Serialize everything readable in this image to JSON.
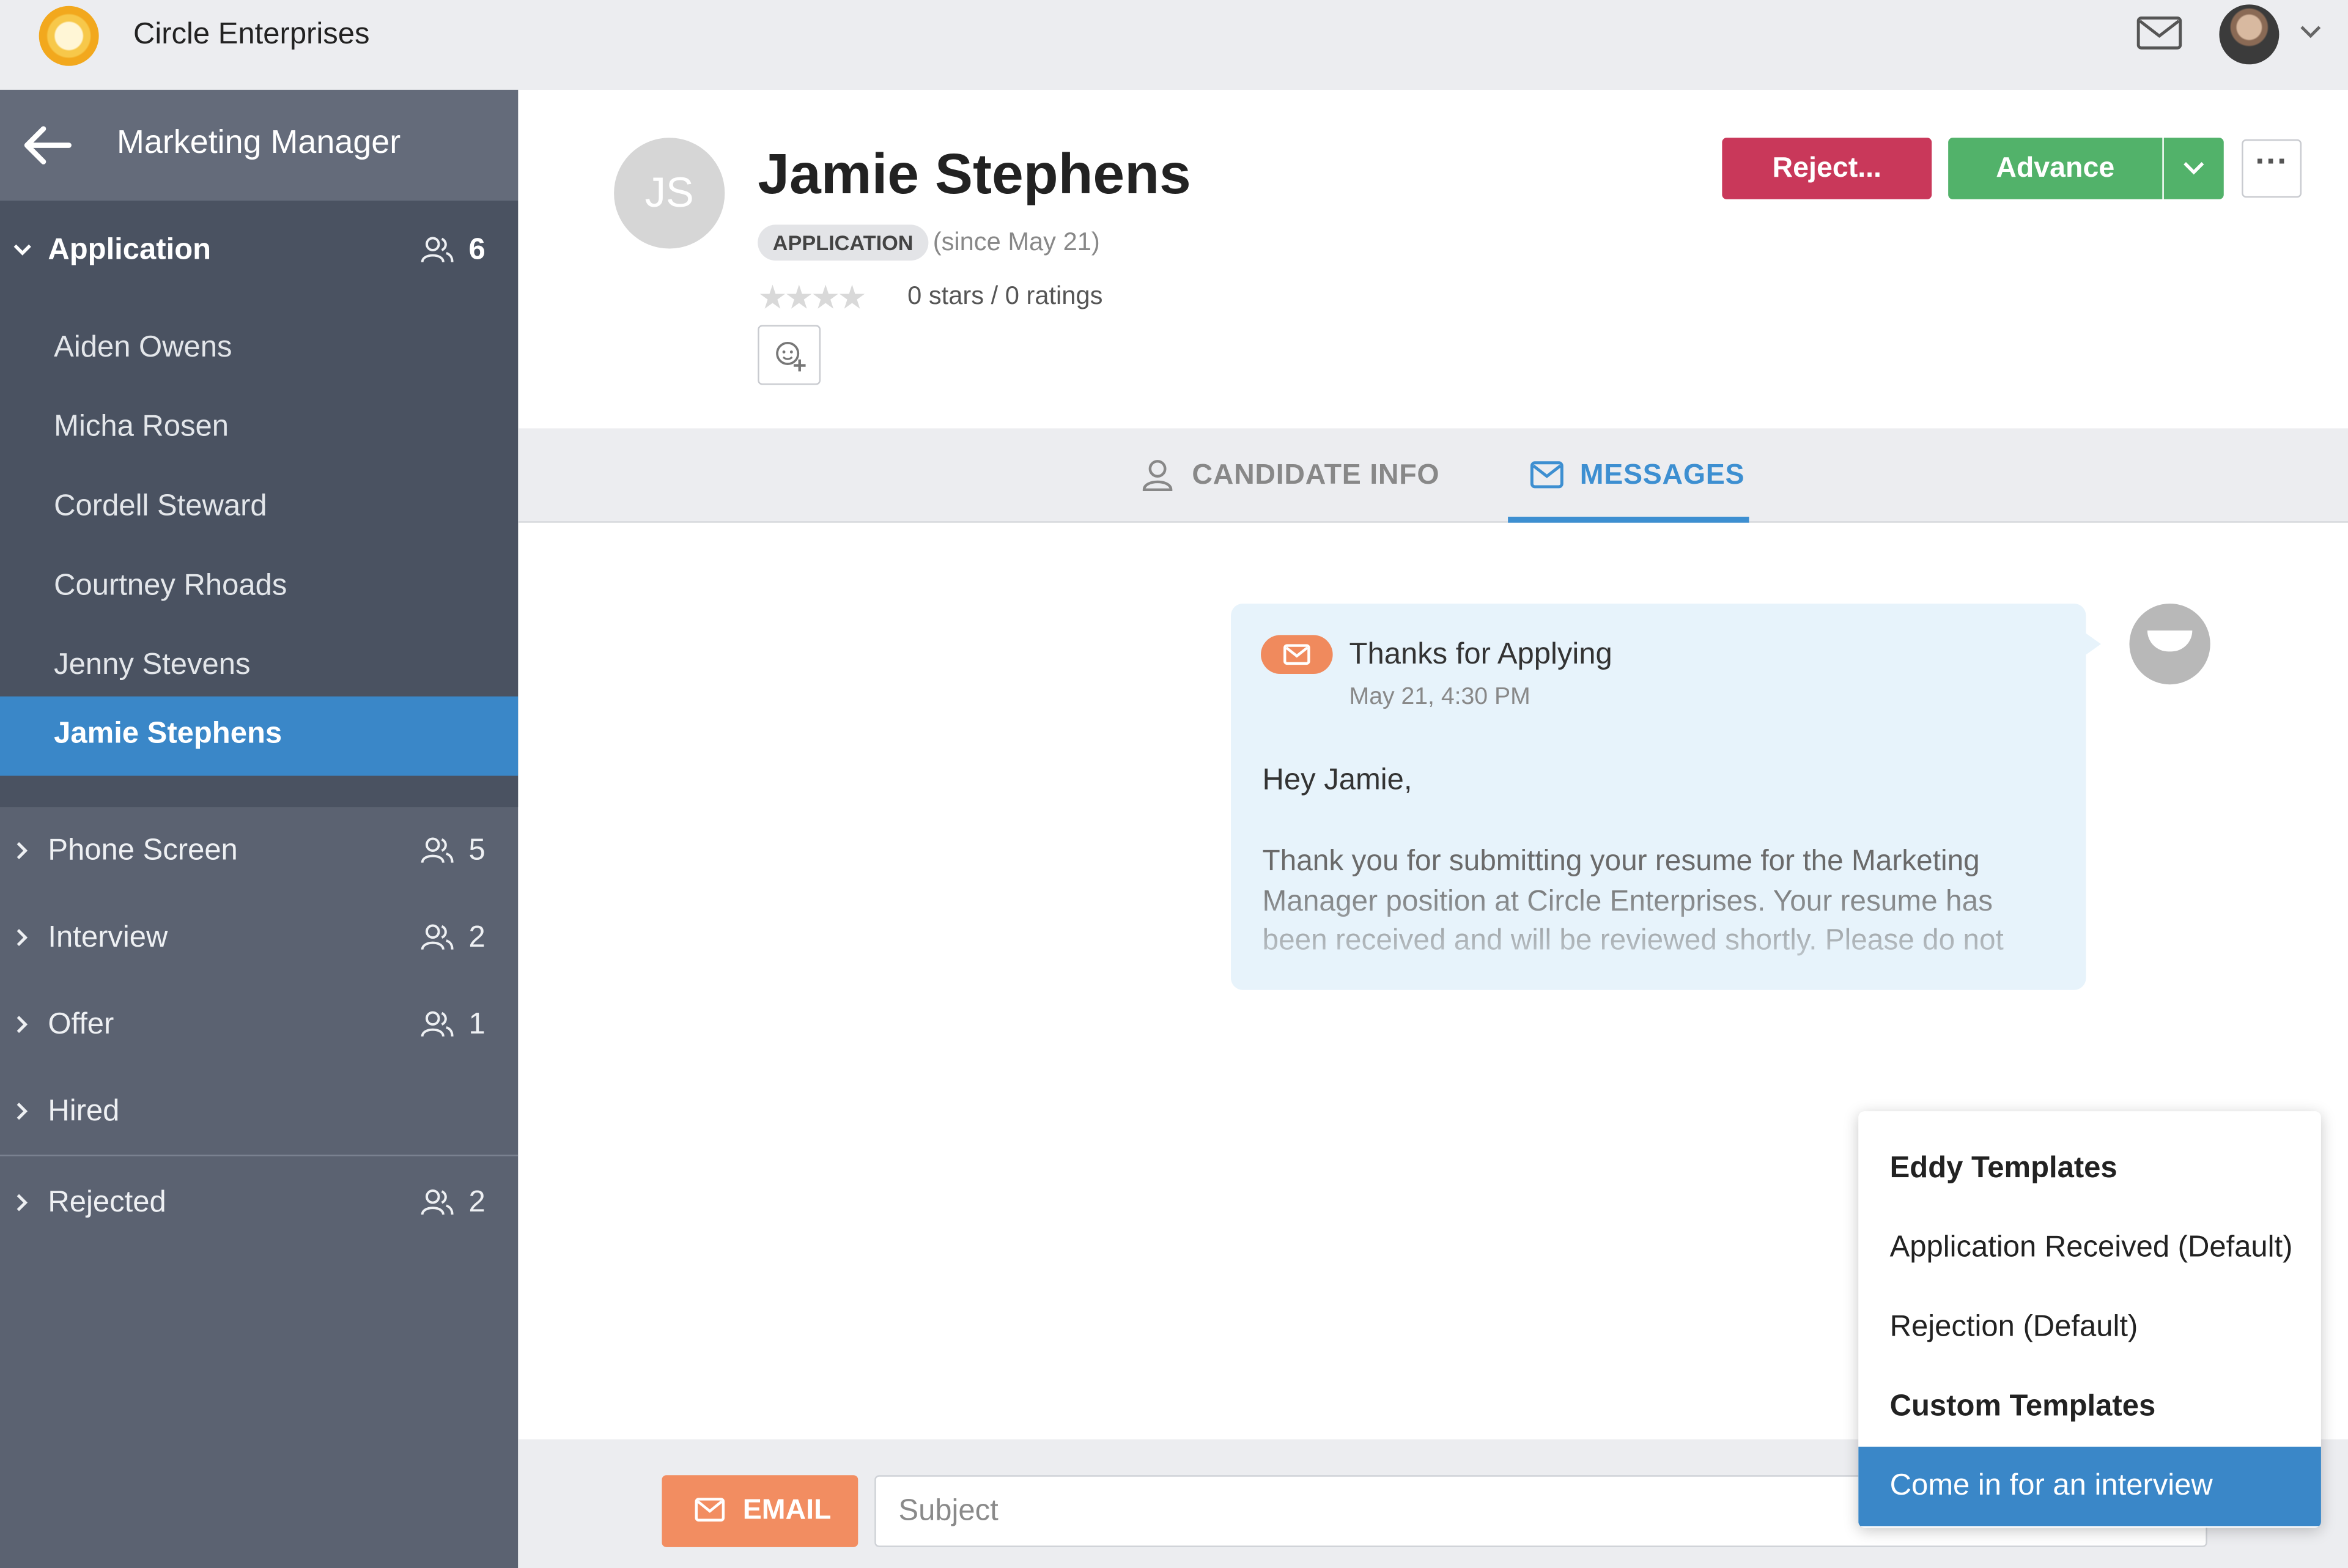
{
  "topbar": {
    "company": "Circle Enterprises",
    "mail_icon": "mail-icon",
    "avatar_icon": "user-avatar",
    "caret_icon": "chevron-down-icon"
  },
  "sidebar": {
    "job_title": "Marketing Manager",
    "stages": [
      {
        "label": "Application",
        "count": "6",
        "expanded": true
      },
      {
        "label": "Phone Screen",
        "count": "5"
      },
      {
        "label": "Interview",
        "count": "2"
      },
      {
        "label": "Offer",
        "count": "1"
      },
      {
        "label": "Hired",
        "count": ""
      },
      {
        "label": "Rejected",
        "count": "2"
      }
    ],
    "candidates": [
      {
        "name": "Aiden Owens"
      },
      {
        "name": "Micha Rosen"
      },
      {
        "name": "Cordell Steward"
      },
      {
        "name": "Courtney Rhoads"
      },
      {
        "name": "Jenny Stevens"
      },
      {
        "name": "Jamie Stephens",
        "selected": true
      }
    ]
  },
  "candidate": {
    "initials": "JS",
    "name": "Jamie Stephens",
    "stage": "APPLICATION",
    "since": "(since May 21)",
    "stars": "★★★★",
    "ratings": "0 stars / 0 ratings"
  },
  "actions": {
    "reject": "Reject...",
    "advance": "Advance",
    "more": "···"
  },
  "tabs": {
    "info": "CANDIDATE INFO",
    "messages": "MESSAGES",
    "active": "messages"
  },
  "message": {
    "subject": "Thanks for Applying",
    "date": "May 21, 4:30 PM",
    "greeting": "Hey Jamie,",
    "body": "Thank you for submitting your resume for the Marketing Manager position at Circle Enterprises. Your resume has been received and will be reviewed shortly. Please do not"
  },
  "compose": {
    "email_label": "EMAIL",
    "subject_placeholder": "Subject"
  },
  "template_menu": {
    "items": [
      {
        "label": "Eddy Templates",
        "type": "header"
      },
      {
        "label": "Application Received (Default)",
        "type": "item"
      },
      {
        "label": "Rejection (Default)",
        "type": "item"
      },
      {
        "label": "Custom Templates",
        "type": "header"
      },
      {
        "label": "Come in for an interview",
        "type": "item",
        "selected": true
      }
    ]
  },
  "colors": {
    "sidebar": "#5b6271",
    "selected": "#3a87c8",
    "reject": "#c9385a",
    "advance": "#52b26a",
    "email": "#f28d61",
    "message_bg": "#e7f3fb"
  }
}
